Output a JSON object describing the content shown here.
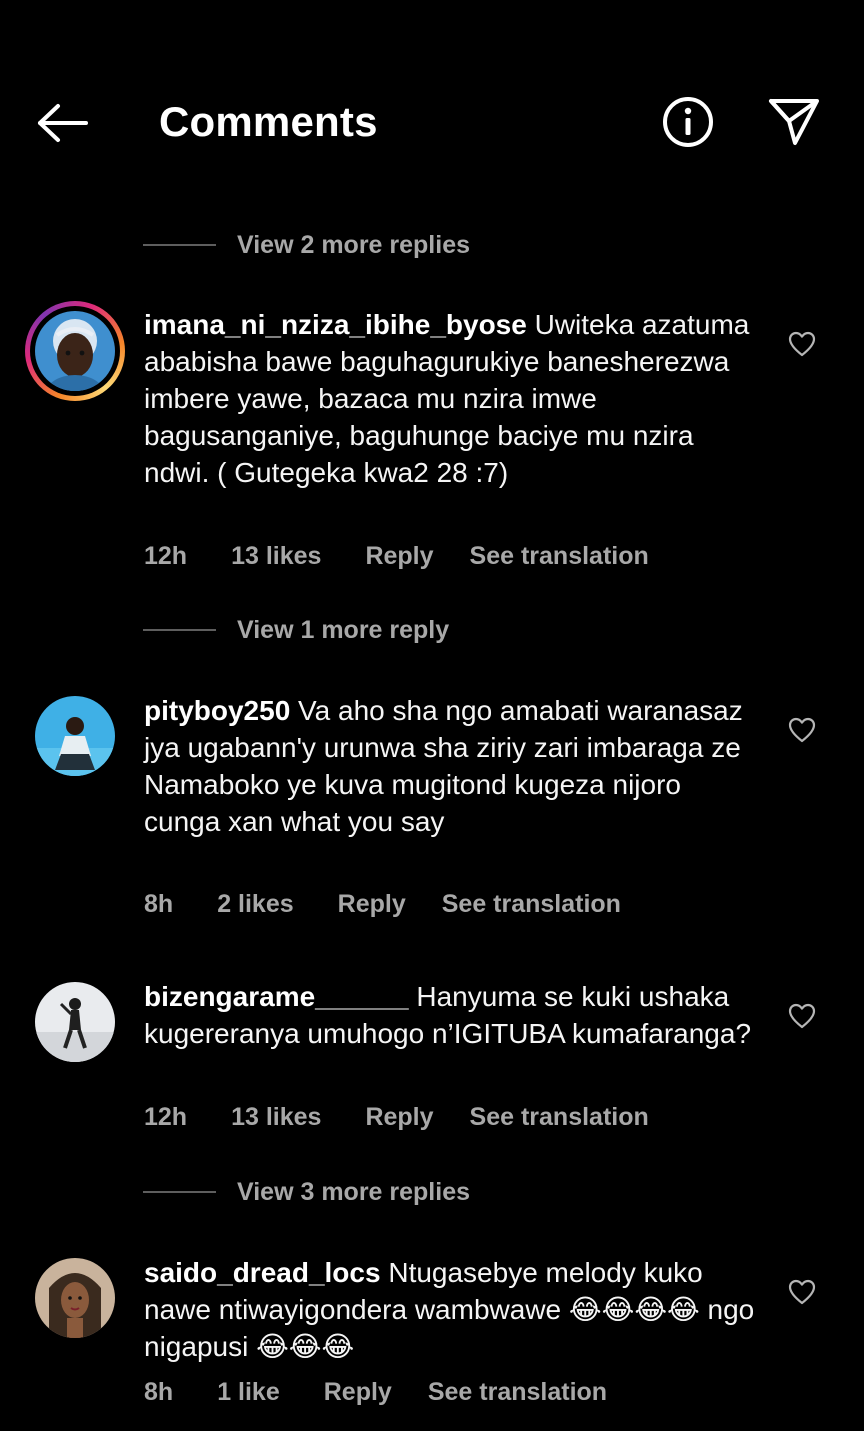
{
  "header": {
    "title": "Comments",
    "back_icon": "arrow-left-icon",
    "info_icon": "info-icon",
    "send_icon": "paper-plane-icon"
  },
  "view_more": [
    {
      "label": "View 2 more replies"
    },
    {
      "label": "View 1 more reply"
    },
    {
      "label": "View 3 more replies"
    }
  ],
  "comments": [
    {
      "username": "imana_ni_nziza_ibihe_byose",
      "text": " Uwiteka azatuma ababisha bawe baguhagurukiye banesherezwa imbere yawe, bazaca mu nzira imwe bagusanganiye, baguhunge baciye mu nzira ndwi. ( Gutegeka kwa2 28 :7)",
      "time": "12h",
      "likes": "13 likes",
      "reply": "Reply",
      "translate": "See translation",
      "has_story": true
    },
    {
      "username": "pityboy250",
      "text": " Va aho sha ngo amabati waranasaz jya ugabann'y urunwa sha ziriy zari imbaraga ze Namaboko ye kuva mugitond kugeza nijoro cunga xan what you say",
      "time": "8h",
      "likes": "2 likes",
      "reply": "Reply",
      "translate": "See translation",
      "has_story": false
    },
    {
      "username": "bizengarame______",
      "text": " Hanyuma se kuki ushaka kugereranya umuhogo n’IGITUBA kumafaranga?",
      "time": "12h",
      "likes": "13 likes",
      "reply": "Reply",
      "translate": "See translation",
      "has_story": false
    },
    {
      "username": "saido_dread_locs",
      "text": " Ntugasebye melody kuko nawe ntiwayigondera wambwawe 😂😂😂😂 ngo nigapusi 😂😂😂",
      "time": "8h",
      "likes": "1 like",
      "reply": "Reply",
      "translate": "See translation",
      "has_story": false
    }
  ],
  "colors": {
    "background": "#000000",
    "text_primary": "#ffffff",
    "text_secondary": "#a8a8a8",
    "divider": "#5e5e5e"
  }
}
